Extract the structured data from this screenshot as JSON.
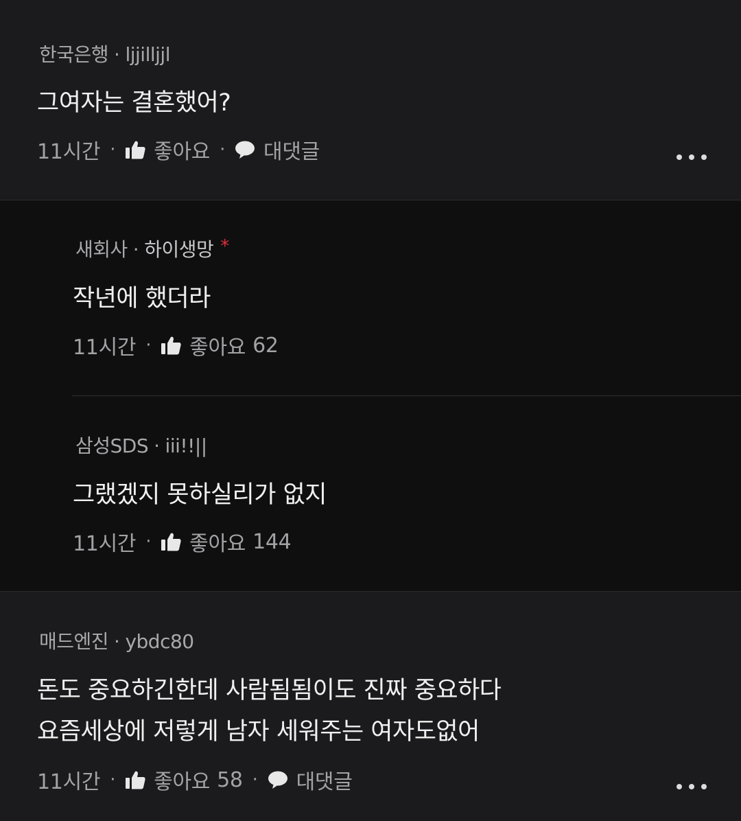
{
  "comments": [
    {
      "company": "한국은행",
      "user": "ljjilljjl",
      "text": "그여자는 결혼했어?",
      "time": "11시간",
      "like_label": "좋아요",
      "reply_label": "대댓글"
    },
    {
      "company": "매드엔진",
      "user": "ybdc80",
      "text_lines": [
        "돈도 중요하긴한데 사람됨됨이도 진짜 중요하다",
        "요즘세상에 저렇게 남자 세워주는 여자도없어"
      ],
      "time": "11시간",
      "like_label": "좋아요",
      "like_count": "58",
      "reply_label": "대댓글"
    }
  ],
  "replies": [
    {
      "company": "새회사",
      "user": "하이생망",
      "star": "*",
      "text": "작년에 했더라",
      "time": "11시간",
      "like_label": "좋아요",
      "like_count": "62"
    },
    {
      "company": "삼성SDS",
      "user": "iii!!||",
      "text": "그랬겠지 못하실리가 없지",
      "time": "11시간",
      "like_label": "좋아요",
      "like_count": "144"
    }
  ],
  "separator": "·",
  "icons": {
    "like": "thumbs-up-icon",
    "reply": "speech-bubble-icon",
    "more": "more-options-icon"
  },
  "colors": {
    "background": "#1b1b1d",
    "reply_background": "#0f0f10",
    "star": "#e0303a"
  }
}
